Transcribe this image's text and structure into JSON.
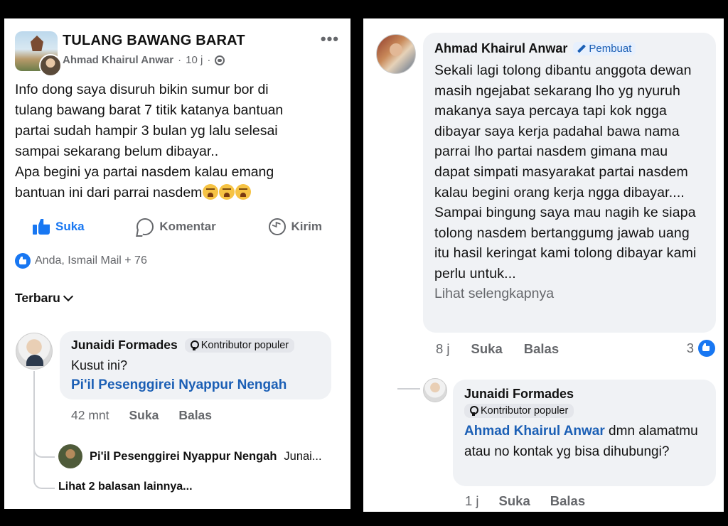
{
  "left": {
    "page_title": "TULANG BAWANG BARAT",
    "author": "Ahmad Khairul Anwar",
    "time": "10 j",
    "dot": "·",
    "more": "•••",
    "post_text": "Info dong saya disuruh bikin sumur bor di\ntulang bawang barat 7 titik katanya bantuan\npartai  sudah hampir 3 bulan yg lalu selesai\nsampai sekarang belum dibayar..\nApa begini ya partai nasdem kalau emang\nbantuan ini dari parrai nasdem",
    "actions": {
      "like": "Suka",
      "comment": "Komentar",
      "send": "Kirim"
    },
    "reactions_text": "Anda, Ismail Mail + 76",
    "sort_label": "Terbaru",
    "comment": {
      "name": "Junaidi Formades",
      "badge": "Kontributor populer",
      "text": "Kusut ini?",
      "mention": "Pi'il Pesenggirei Nyappur Nengah",
      "time": "42 mnt",
      "like": "Suka",
      "reply": "Balas"
    },
    "reply_preview": {
      "name": "Pi'il Pesenggirei Nyappur Nengah",
      "snippet": "Junai..."
    },
    "more_replies": "Lihat 2 balasan lainnya..."
  },
  "right": {
    "comment1": {
      "name": "Ahmad Khairul Anwar",
      "badge": "Pembuat",
      "text": "Sekali lagi tolong dibantu anggota dewan masih ngejabat sekarang lho yg nyuruh makanya saya percaya tapi kok ngga dibayar saya kerja padahal bawa nama parrai lho partai nasdem gimana mau dapat simpati masyarakat partai nasdem kalau begini orang kerja ngga dibayar.... Sampai bingung saya mau nagih ke siapa tolong nasdem bertanggumg jawab uang itu hasil keringat kami tolong dibayar kami perlu untuk...",
      "see_more": "Lihat selengkapnya",
      "time": "8 j",
      "like": "Suka",
      "reply": "Balas",
      "like_count": "3"
    },
    "comment2": {
      "name": "Junaidi Formades",
      "badge": "Kontributor populer",
      "mention": "Ahmad Khairul Anwar",
      "text": " dmn alamatmu atau no kontak yg bisa dihubungi?",
      "time": "1 j",
      "like": "Suka",
      "reply": "Balas"
    }
  },
  "colors": {
    "accent": "#1877f2",
    "mention": "#1b5fb5",
    "bubble": "#f0f2f5",
    "muted": "#65676b"
  },
  "icons": [
    "more-icon",
    "globe-icon",
    "like-icon",
    "comment-icon",
    "send-icon",
    "reaction-like-icon",
    "chevron-down-icon",
    "badge-icon",
    "pencil-icon",
    "crying-emoji"
  ]
}
